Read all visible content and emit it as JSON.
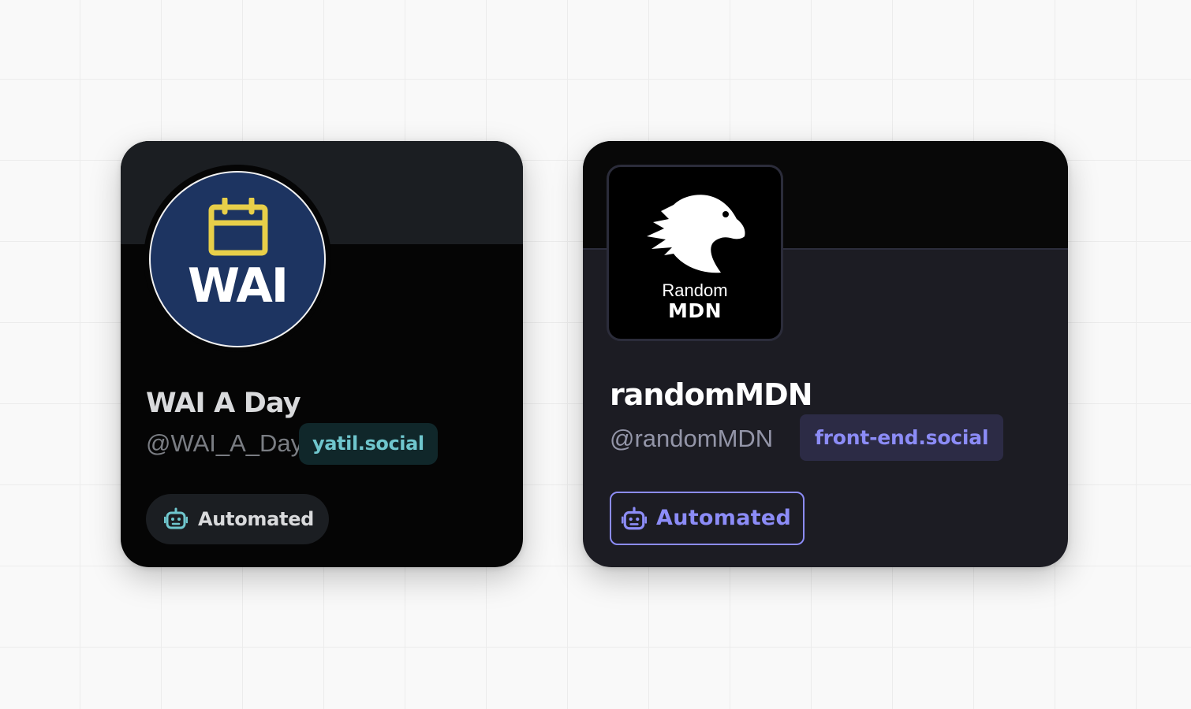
{
  "cards": [
    {
      "avatar_text": "WAI",
      "display_name": "WAI A Day",
      "handle": "@WAI_A_Day",
      "domain": "yatil.social",
      "badge_label": "Automated",
      "avatar_icon": "calendar-icon",
      "badge_icon": "robot-icon",
      "colors": {
        "avatar_bg": "#1d3461",
        "icon": "#e8cf49",
        "domain_text": "#6fc6cd"
      }
    },
    {
      "avatar_text_small": "Random",
      "avatar_text_big": "MDN",
      "display_name": "randomMDN",
      "handle": "@randomMDN",
      "domain": "front-end.social",
      "badge_label": "Automated",
      "avatar_icon": "dinosaur-head-icon",
      "badge_icon": "robot-icon",
      "colors": {
        "accent": "#8c8cf7",
        "domain_bg": "#2c2b45"
      }
    }
  ]
}
